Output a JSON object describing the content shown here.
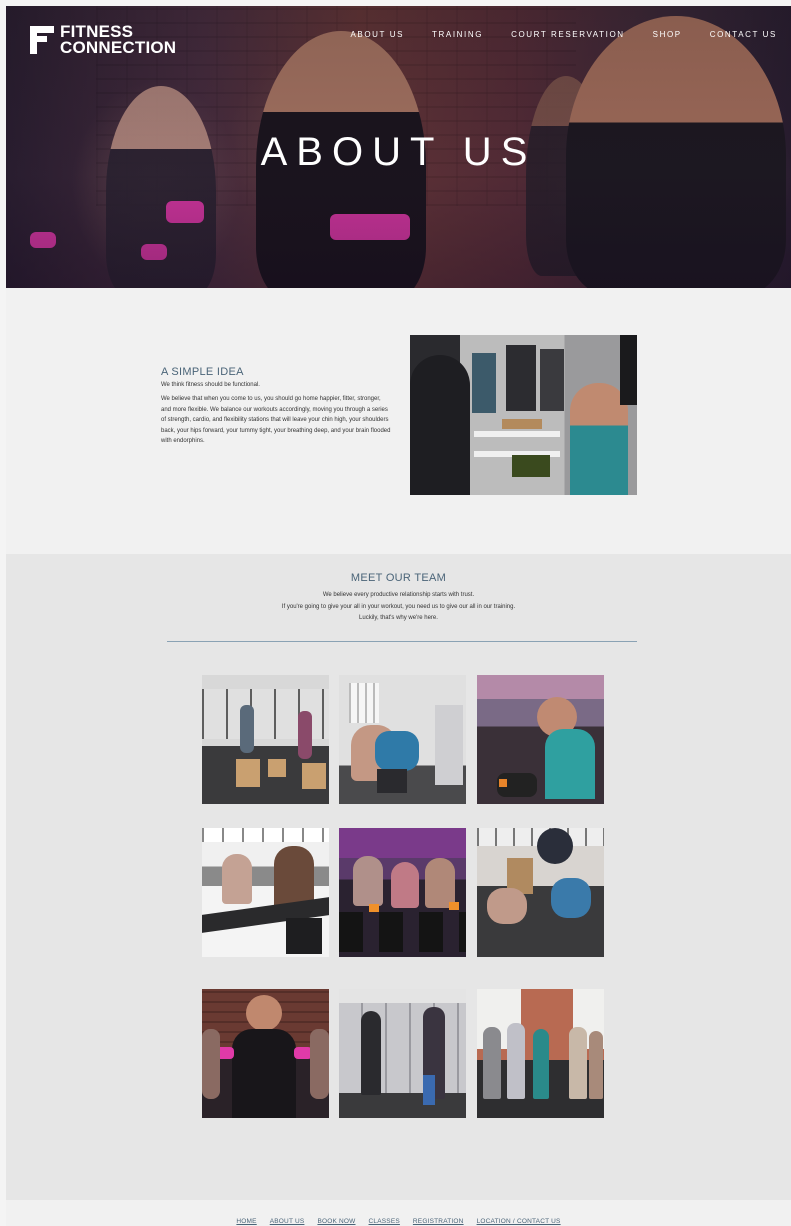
{
  "brand": {
    "name_line1": "FITNESS",
    "name_line2": "CONNECTION"
  },
  "nav": {
    "items": [
      "ABOUT US",
      "TRAINING",
      "COURT RESERVATION",
      "SHOP",
      "CONTACT US"
    ]
  },
  "hero": {
    "title": "ABOUT US"
  },
  "idea": {
    "heading": "A SIMPLE IDEA",
    "lead": "We think fitness should be functional.",
    "body": "We believe that when you come to us, you should go home happier, fitter, stronger, and more flexible. We balance our workouts accordingly, moving you through a series of strength, cardio, and flexibility stations that will leave your chin high, your shoulders back, your hips forward, your tummy tight, your breathing deep, and your brain flooded with endorphins."
  },
  "team": {
    "heading": "MEET OUR TEAM",
    "lines": [
      "We believe every productive relationship starts with trust.",
      "If you're going to give your all in your workout, you need us to give our all in our training.",
      "Luckily, that's why we're here."
    ]
  },
  "footer": {
    "links": [
      "HOME",
      "ABOUT US",
      "BOOK NOW",
      "CLASSES",
      "REGISTRATION",
      "LOCATION / CONTACT US"
    ]
  },
  "colors": {
    "accent_heading": "#4a6478",
    "dumbbell_pink": "#e03aa8",
    "section_light": "#f1f1f1",
    "section_grey": "#e6e6e6"
  }
}
